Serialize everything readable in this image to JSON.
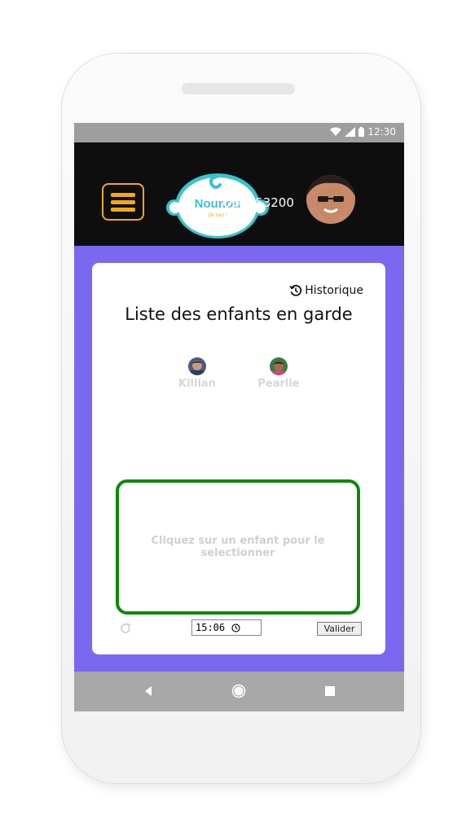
{
  "status_bar": {
    "time": "12:30",
    "icons": [
      "wifi-icon",
      "signal-icon",
      "battery-icon"
    ]
  },
  "app_bar": {
    "menu_icon": "hamburger-icon",
    "logo_text": "Nounou",
    "logo_subtext": "On tour !",
    "user": {
      "name": "Ophé53200",
      "avatar": "user-avatar"
    }
  },
  "card": {
    "history_label": "Historique",
    "history_icon": "history-icon",
    "title": "Liste des enfants en garde",
    "children": [
      {
        "name": "Killian"
      },
      {
        "name": "Pearlie"
      }
    ],
    "select_prompt": "Cliquez sur un enfant pour le selectionner",
    "time_value": "15:06",
    "validate_label": "Valider"
  },
  "nav_bar": {
    "buttons": [
      "back-icon",
      "home-icon",
      "recents-icon"
    ]
  },
  "colors": {
    "appbar_bg": "#0e0e0e",
    "accent_orange": "#f3a81c",
    "content_bg": "#7b68f0",
    "select_border": "#0b8a0b",
    "logo_teal": "#39c2cf",
    "status_bar": "#9e9e9e",
    "nav_bar": "#a8a8a8"
  }
}
